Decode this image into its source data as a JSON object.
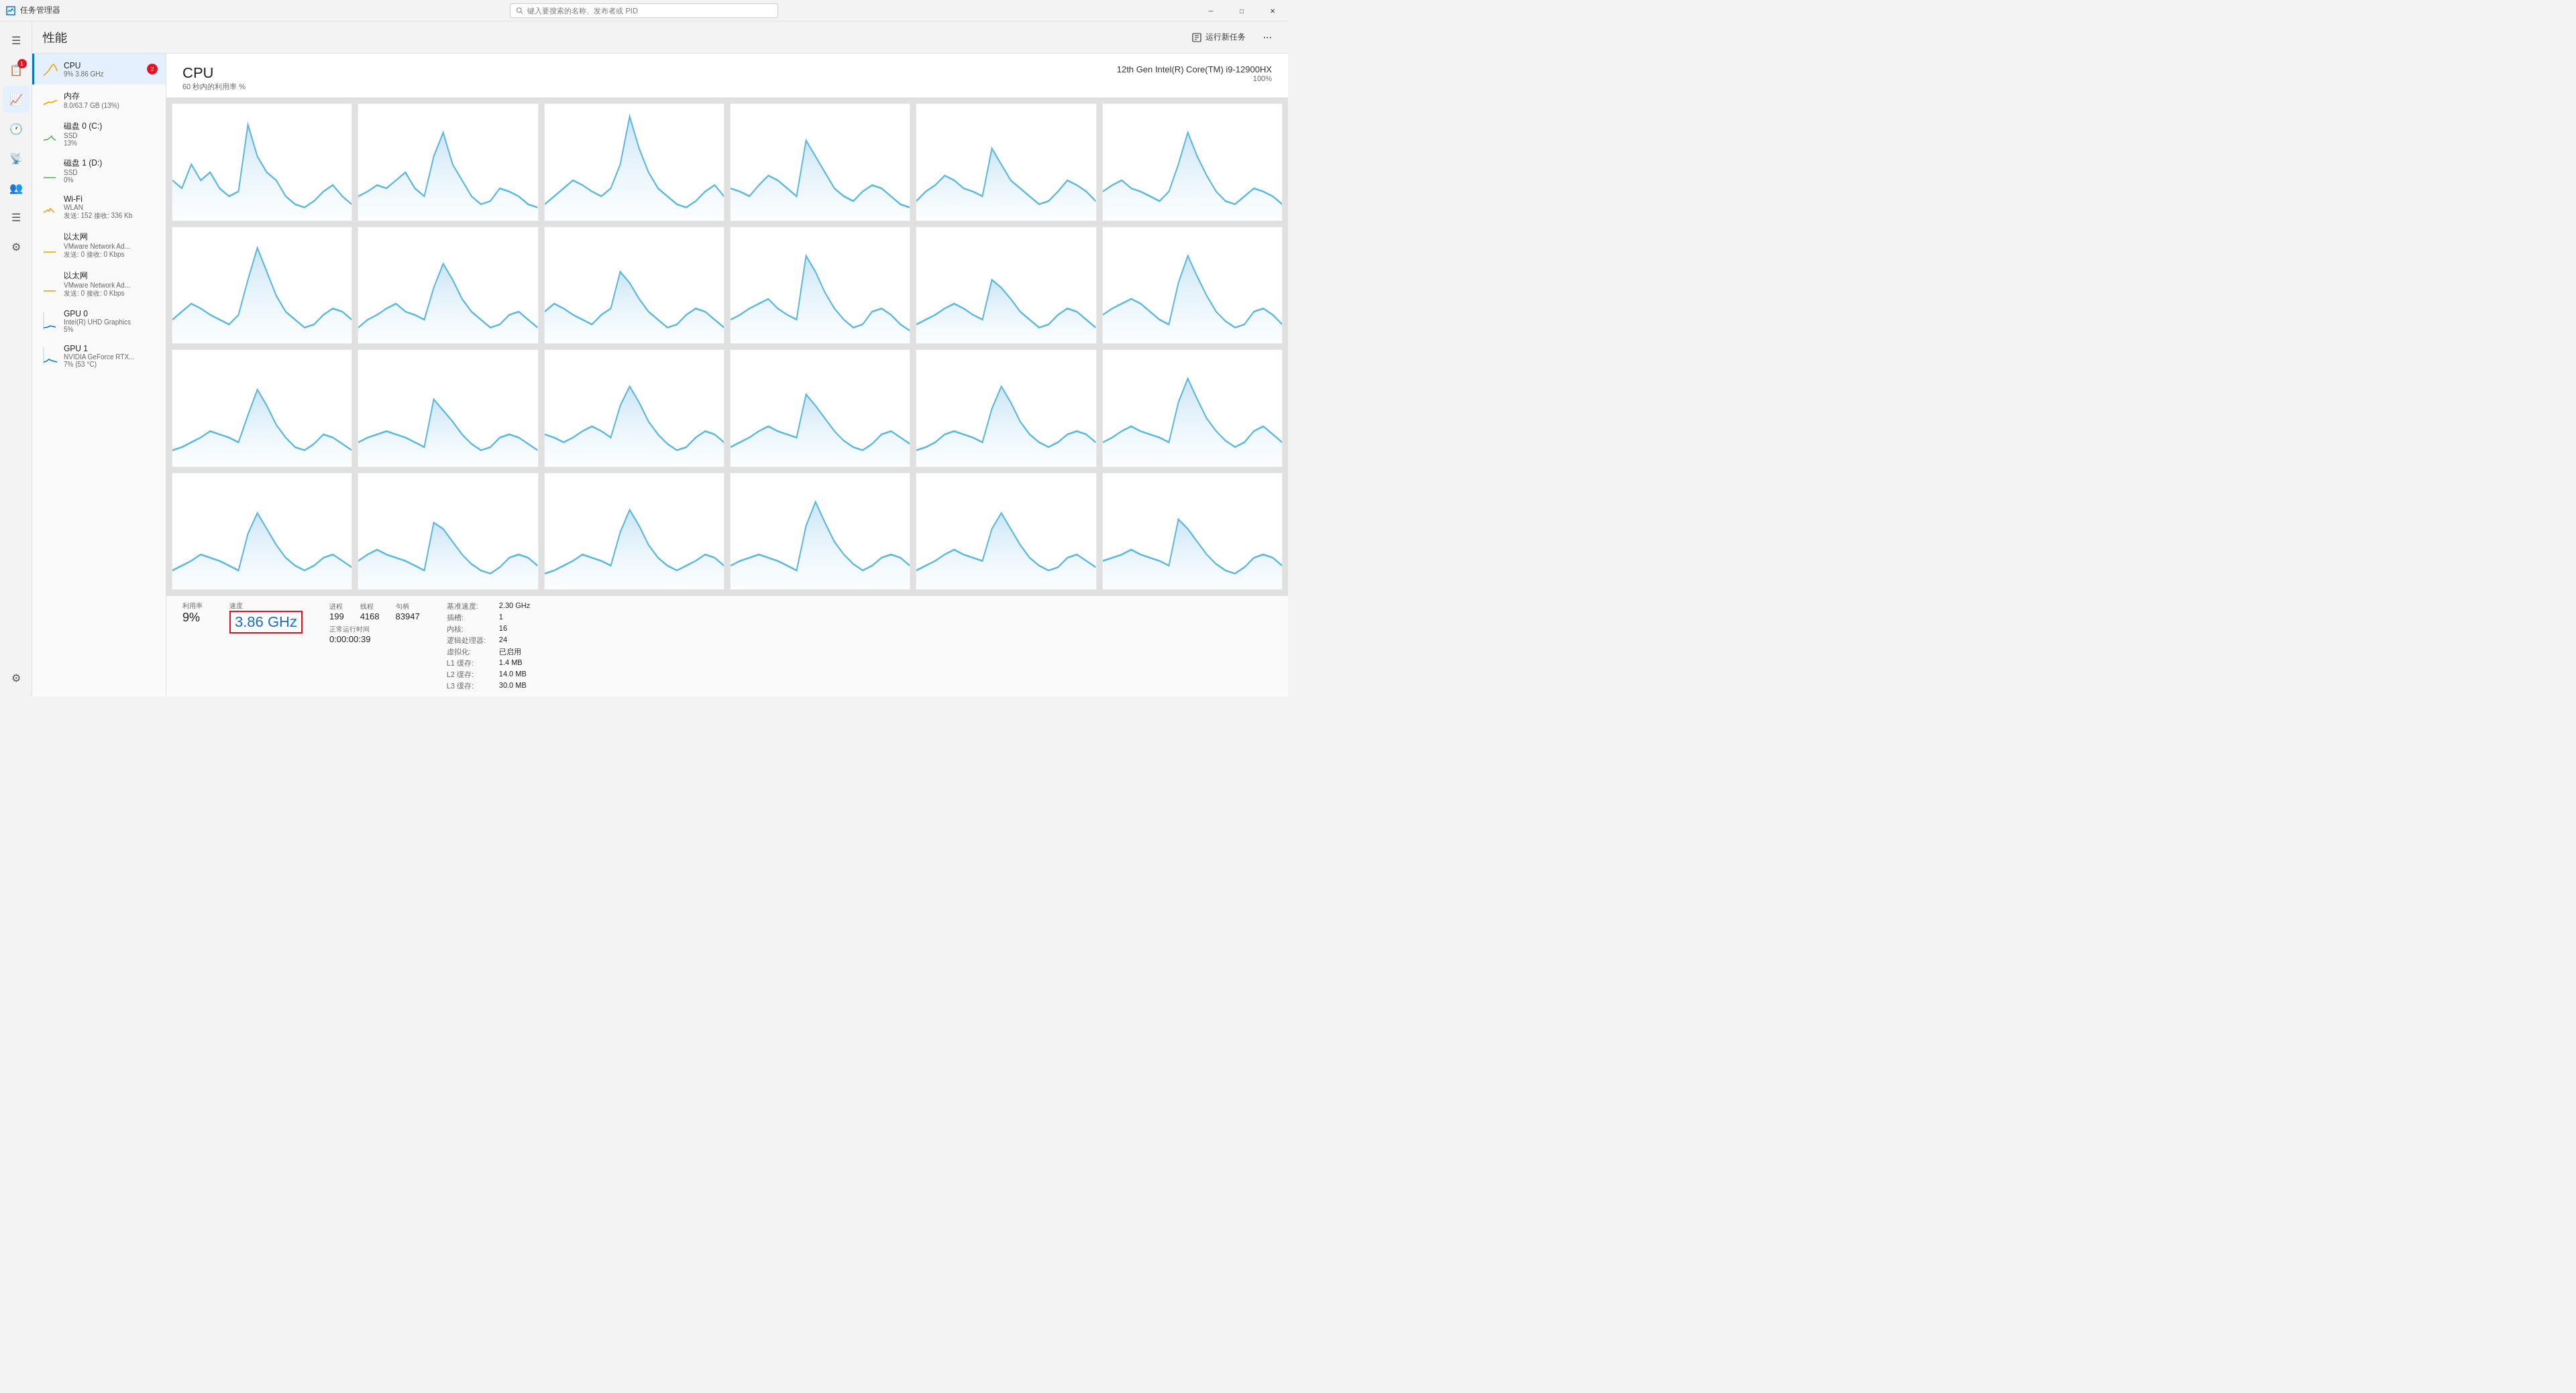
{
  "app": {
    "title": "任务管理器",
    "search_placeholder": "键入要搜索的名称、发布者或 PID"
  },
  "titlebar": {
    "minimize": "─",
    "restore": "□",
    "close": "✕"
  },
  "nav": {
    "items": [
      {
        "name": "menu",
        "icon": "☰",
        "active": false,
        "badge": null
      },
      {
        "name": "processes",
        "icon": "📋",
        "active": false,
        "badge": "1"
      },
      {
        "name": "performance",
        "icon": "📈",
        "active": true,
        "badge": null
      },
      {
        "name": "history",
        "icon": "🕐",
        "active": false,
        "badge": null
      },
      {
        "name": "startup",
        "icon": "📡",
        "active": false,
        "badge": null
      },
      {
        "name": "users",
        "icon": "👥",
        "active": false,
        "badge": null
      },
      {
        "name": "details",
        "icon": "☰",
        "active": false,
        "badge": null
      },
      {
        "name": "services",
        "icon": "⚙",
        "active": false,
        "badge": null
      }
    ],
    "settings": {
      "icon": "⚙",
      "name": "settings"
    }
  },
  "topbar": {
    "title": "性能",
    "run_task_label": "运行新任务"
  },
  "sidebar": {
    "items": [
      {
        "name": "CPU",
        "detail": "9%  3.86 GHz",
        "active": true,
        "badge": "2"
      },
      {
        "name": "内存",
        "detail": "8.0/63.7 GB (13%)",
        "active": false
      },
      {
        "name": "磁盘 0 (C:)",
        "detail": "SSD\n13%",
        "active": false
      },
      {
        "name": "磁盘 1 (D:)",
        "detail": "SSD\n0%",
        "active": false
      },
      {
        "name": "Wi-Fi",
        "detail": "WLAN\n发送: 152  接收: 336 Kb",
        "active": false
      },
      {
        "name": "以太网",
        "detail": "VMware Network Ad...\n发送: 0  接收: 0 Kbps",
        "active": false
      },
      {
        "name": "以太网",
        "detail": "VMware Network Ad...\n发送: 0  接收: 0 Kbps",
        "active": false
      },
      {
        "name": "GPU 0",
        "detail": "Intel(R) UHD Graphics\n5%",
        "active": false
      },
      {
        "name": "GPU 1",
        "detail": "NVIDIA GeForce RTX...\n7% (53 °C)",
        "active": false
      }
    ]
  },
  "cpu": {
    "title": "CPU",
    "subtitle": "60 秒内的利用率 %",
    "model": "12th Gen Intel(R) Core(TM) i9-12900HX",
    "utilization_label": "100%",
    "stats": {
      "utilization_label": "利用率",
      "utilization_value": "9%",
      "speed_label": "速度",
      "speed_value": "3.86 GHz",
      "processes_label": "进程",
      "processes_value": "199",
      "threads_label": "线程",
      "threads_value": "4168",
      "handles_label": "句柄",
      "handles_value": "83947",
      "uptime_label": "正常运行时间",
      "uptime_value": "0:00:00:39"
    },
    "details": {
      "base_speed_label": "基准速度:",
      "base_speed_value": "2.30 GHz",
      "sockets_label": "插槽:",
      "sockets_value": "1",
      "cores_label": "内核:",
      "cores_value": "16",
      "logical_processors_label": "逻辑处理器:",
      "logical_processors_value": "24",
      "virtualization_label": "虚拟化:",
      "virtualization_value": "已启用",
      "l1_cache_label": "L1 缓存:",
      "l1_cache_value": "1.4 MB",
      "l2_cache_label": "L2 缓存:",
      "l2_cache_value": "14.0 MB",
      "l3_cache_label": "L3 缓存:",
      "l3_cache_value": "30.0 MB"
    }
  }
}
